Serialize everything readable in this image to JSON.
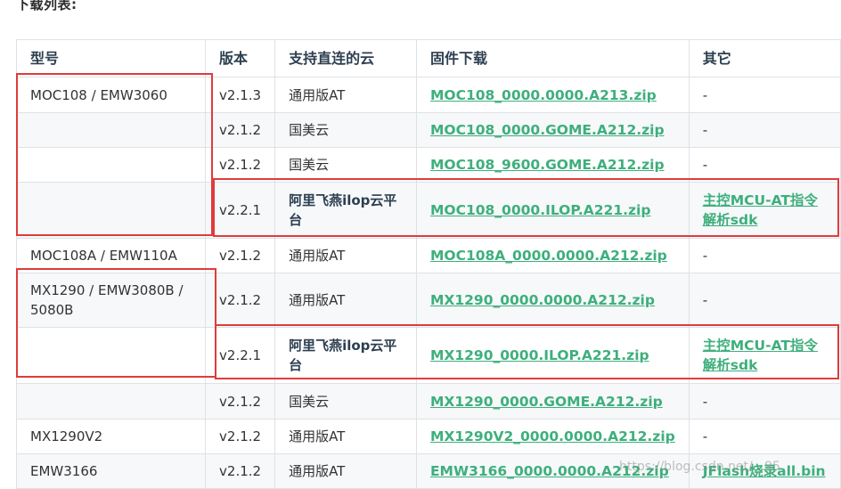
{
  "page": {
    "heading": "下载列表:"
  },
  "table": {
    "headers": [
      "型号",
      "版本",
      "支持直连的云",
      "固件下载",
      "其它"
    ],
    "rows": [
      {
        "model": "MOC108 / EMW3060",
        "version": "v2.1.3",
        "cloud": "通用版AT",
        "firmware": "MOC108_0000.0000.A213.zip",
        "other": "-"
      },
      {
        "model": "",
        "version": "v2.1.2",
        "cloud": "国美云",
        "firmware": "MOC108_0000.GOME.A212.zip",
        "other": "-"
      },
      {
        "model": "",
        "version": "v2.1.2",
        "cloud": "国美云",
        "firmware": "MOC108_9600.GOME.A212.zip",
        "other": "-"
      },
      {
        "model": "",
        "version": "v2.2.1",
        "cloud": "阿里飞燕ilop云平台",
        "firmware": "MOC108_0000.ILOP.A221.zip",
        "other": "主控MCU-AT指令解析sdk"
      },
      {
        "model": "MOC108A / EMW110A",
        "version": "v2.1.2",
        "cloud": "通用版AT",
        "firmware": "MOC108A_0000.0000.A212.zip",
        "other": "-"
      },
      {
        "model": "MX1290 / EMW3080B / 5080B",
        "version": "v2.1.2",
        "cloud": "通用版AT",
        "firmware": "MX1290_0000.0000.A212.zip",
        "other": "-"
      },
      {
        "model": "",
        "version": "v2.2.1",
        "cloud": "阿里飞燕ilop云平台",
        "firmware": "MX1290_0000.ILOP.A221.zip",
        "other": "主控MCU-AT指令解析sdk"
      },
      {
        "model": "",
        "version": "v2.1.2",
        "cloud": "国美云",
        "firmware": "MX1290_0000.GOME.A212.zip",
        "other": "-"
      },
      {
        "model": "MX1290V2",
        "version": "v2.1.2",
        "cloud": "通用版AT",
        "firmware": "MX1290V2_0000.0000.A212.zip",
        "other": "-"
      },
      {
        "model": "EMW3166",
        "version": "v2.1.2",
        "cloud": "通用版AT",
        "firmware": "EMW3166_0000.0000.A212.zip",
        "other": "JFlash烧录all.bin"
      }
    ]
  },
  "watermark": "https://blog.csdn.net/...95",
  "colors": {
    "link": "#3eaf7c",
    "highlight_box": "#e03b3b",
    "stripe": "#f6f8fa",
    "border": "#dfe2e5"
  }
}
